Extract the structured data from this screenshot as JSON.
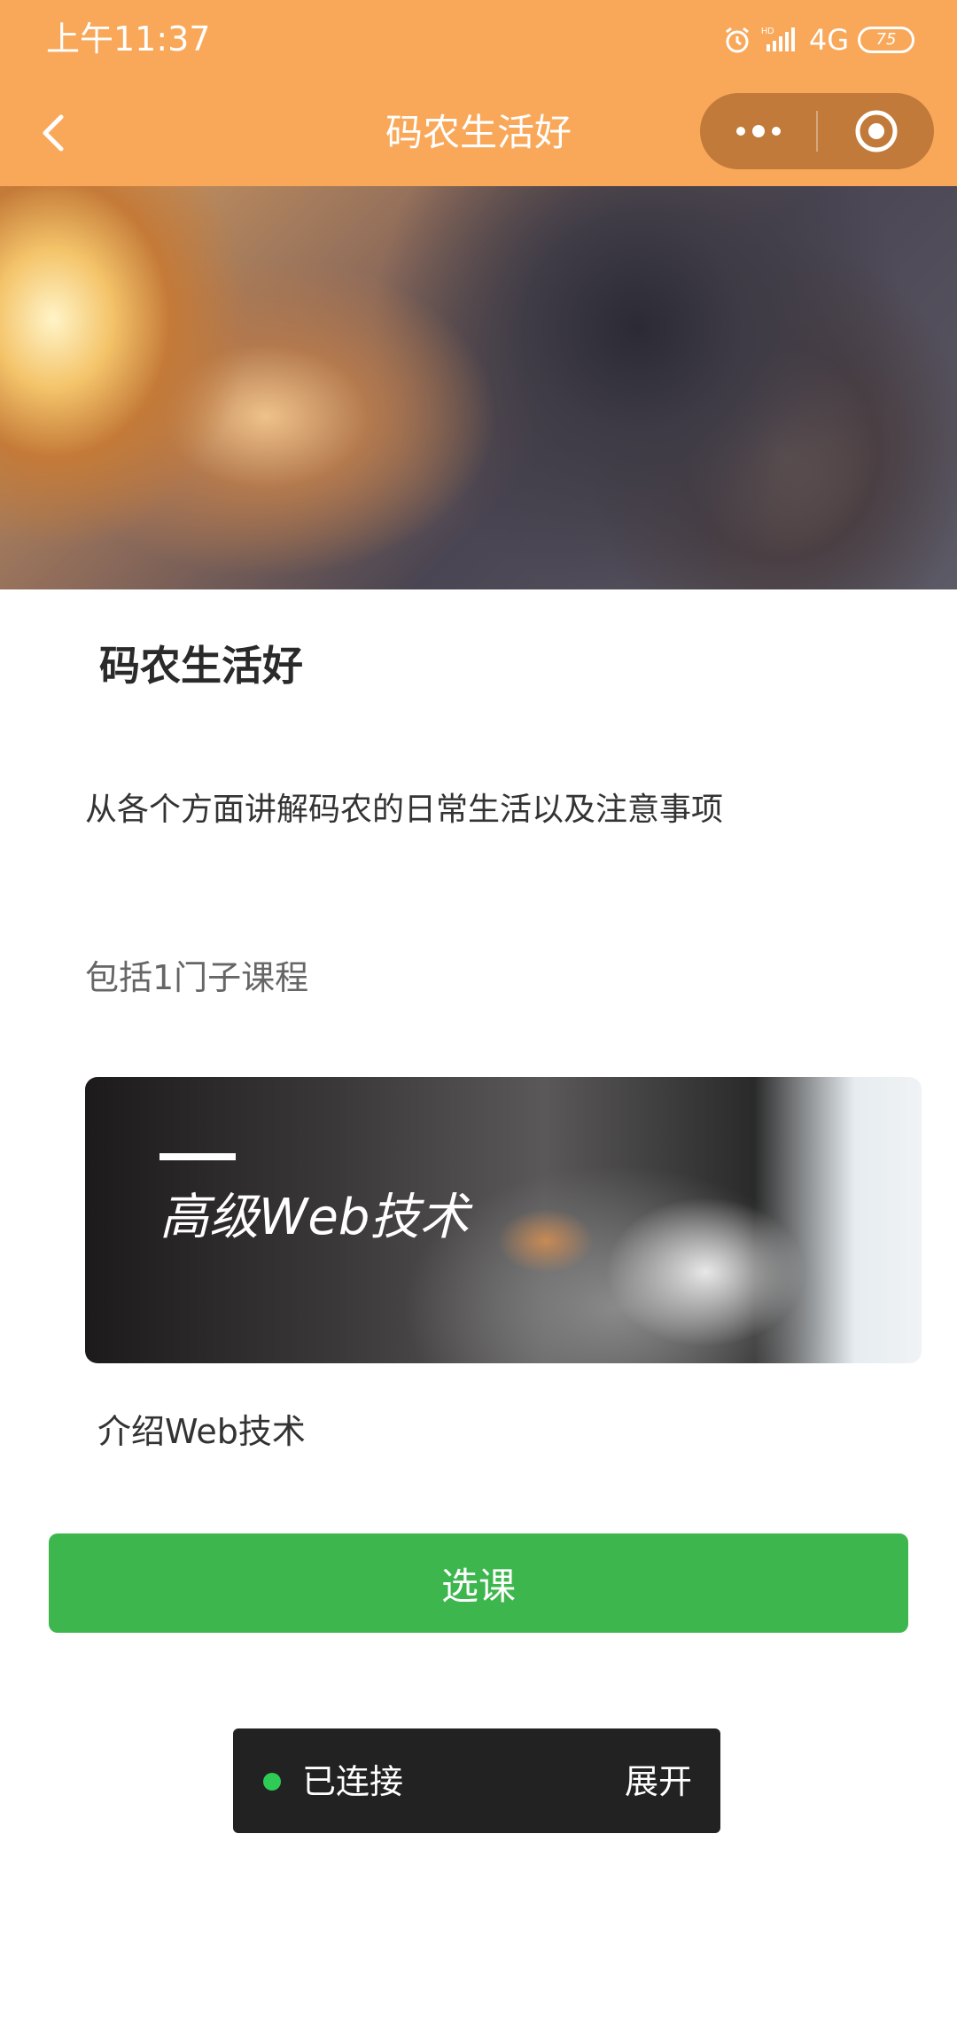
{
  "status_bar": {
    "time": "上午11:37",
    "network": "4G",
    "battery": "75"
  },
  "nav": {
    "title": "码农生活好"
  },
  "course": {
    "title": "码农生活好",
    "description": "从各个方面讲解码农的日常生活以及注意事项",
    "sub_count_label": "包括1门子课程"
  },
  "sub_course": {
    "image_caption": "高级Web技术",
    "description": "介绍Web技术"
  },
  "actions": {
    "select_label": "选课"
  },
  "debug_panel": {
    "status": "已连接",
    "expand_label": "展开"
  },
  "colors": {
    "header": "#f9a85a",
    "capsule": "#c17a3a",
    "primary_button": "#3cb64d",
    "panel": "#222222",
    "connected_dot": "#2ecc54"
  }
}
